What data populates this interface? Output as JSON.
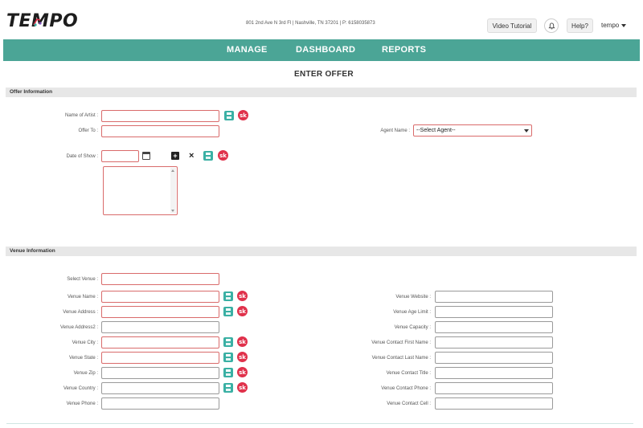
{
  "header": {
    "logo_text": "TEMPO",
    "address": "801 2nd Ave N 3rd Fl | Nashville, TN 37201 | P: 6158035873",
    "video_label": "Video Tutorial",
    "help_label": "Help?",
    "user_label": "tempo"
  },
  "nav": {
    "manage": "MANAGE",
    "dashboard": "DASHBOARD",
    "reports": "REPORTS"
  },
  "page_title": "ENTER OFFER",
  "offer": {
    "section_title": "Offer Information",
    "artist_label": "Name of Artist :",
    "offer_to_label": "Offer To :",
    "date_label": "Date of Show :",
    "agent_label": "Agent Name :",
    "agent_selected": "--Select Agent--",
    "sk_text": "sk"
  },
  "venue": {
    "section_title": "Venue Information",
    "select_venue_label": "Select Venue :",
    "left_labels": [
      "Venue Name :",
      "Venue Address :",
      "Venue Address2 :",
      "Venue City :",
      "Venue State :",
      "Venue Zip :",
      "Venue Country :",
      "Venue Phone :"
    ],
    "right_labels": [
      "Venue Website :",
      "Venue Age Limit :",
      "Venue Capacity :",
      "Venue Contact First Name :",
      "Venue Contact Last Name :",
      "Venue Contact Title :",
      "Venue Contact Phone :",
      "Venue Contact Cell :"
    ]
  }
}
